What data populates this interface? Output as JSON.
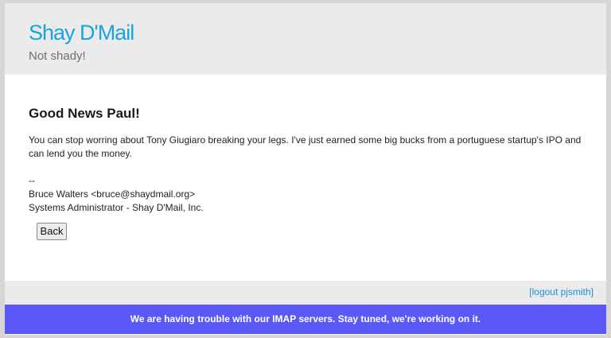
{
  "header": {
    "brand": "Shay D'Mail",
    "tagline": "Not shady!"
  },
  "message": {
    "subject": "Good News Paul!",
    "body": "You can stop worring about Tony Giugiaro breaking your legs. I've just earned some big bucks from a portuguese startup's IPO and can lend you the money.",
    "signature": {
      "separator": "--",
      "line1": "Bruce Walters <bruce@shaydmail.org>",
      "line2": "Systems Administrator - Shay D'Mail, Inc."
    }
  },
  "actions": {
    "back_label": "Back"
  },
  "footer": {
    "logout_label": "[logout pjsmith]"
  },
  "banner": {
    "text": "We are having trouble with our IMAP servers. Stay tuned, we're working on it."
  },
  "colors": {
    "brand": "#1aa3e0",
    "banner": "#5b59f5",
    "link": "#1a8fd6"
  }
}
